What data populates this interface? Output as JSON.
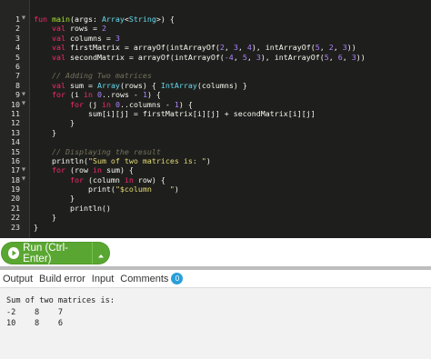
{
  "colors": {
    "keyword": "#f92672",
    "type": "#66d9ef",
    "func": "#a6e22e",
    "number": "#ae81ff",
    "string": "#e6db74",
    "comment": "#75715e",
    "plain": "#f8f8f2",
    "run_green": "#5aa632",
    "badge_blue": "#2a9fd8"
  },
  "editor": {
    "lines": [
      {
        "n": "1",
        "fold": true,
        "tokens": [
          [
            "k",
            "fun "
          ],
          [
            "f",
            "main"
          ],
          [
            "p",
            "(args: "
          ],
          [
            "t",
            "Array"
          ],
          [
            "p",
            "<"
          ],
          [
            "t",
            "String"
          ],
          [
            "p",
            ">) {"
          ]
        ]
      },
      {
        "n": "2",
        "fold": false,
        "tokens": [
          [
            "i",
            "    "
          ],
          [
            "k",
            "val "
          ],
          [
            "p",
            "rows = "
          ],
          [
            "m",
            "2"
          ]
        ]
      },
      {
        "n": "3",
        "fold": false,
        "tokens": [
          [
            "i",
            "    "
          ],
          [
            "k",
            "val "
          ],
          [
            "p",
            "columns = "
          ],
          [
            "m",
            "3"
          ]
        ]
      },
      {
        "n": "4",
        "fold": false,
        "tokens": [
          [
            "i",
            "    "
          ],
          [
            "k",
            "val "
          ],
          [
            "p",
            "firstMatrix = arrayOf(intArrayOf("
          ],
          [
            "m",
            "2"
          ],
          [
            "p",
            ", "
          ],
          [
            "m",
            "3"
          ],
          [
            "p",
            ", "
          ],
          [
            "m",
            "4"
          ],
          [
            "p",
            "), intArrayOf("
          ],
          [
            "m",
            "5"
          ],
          [
            "p",
            ", "
          ],
          [
            "m",
            "2"
          ],
          [
            "p",
            ", "
          ],
          [
            "m",
            "3"
          ],
          [
            "p",
            "))"
          ]
        ]
      },
      {
        "n": "5",
        "fold": false,
        "tokens": [
          [
            "i",
            "    "
          ],
          [
            "k",
            "val "
          ],
          [
            "p",
            "secondMatrix = arrayOf(intArrayOf("
          ],
          [
            "m",
            "-4"
          ],
          [
            "p",
            ", "
          ],
          [
            "m",
            "5"
          ],
          [
            "p",
            ", "
          ],
          [
            "m",
            "3"
          ],
          [
            "p",
            "), intArrayOf("
          ],
          [
            "m",
            "5"
          ],
          [
            "p",
            ", "
          ],
          [
            "m",
            "6"
          ],
          [
            "p",
            ", "
          ],
          [
            "m",
            "3"
          ],
          [
            "p",
            "))"
          ]
        ]
      },
      {
        "n": "6",
        "fold": false,
        "tokens": []
      },
      {
        "n": "7",
        "fold": false,
        "tokens": [
          [
            "i",
            "    "
          ],
          [
            "c",
            "// Adding Two matrices"
          ]
        ]
      },
      {
        "n": "8",
        "fold": false,
        "tokens": [
          [
            "i",
            "    "
          ],
          [
            "k",
            "val "
          ],
          [
            "p",
            "sum = "
          ],
          [
            "t",
            "Array"
          ],
          [
            "p",
            "(rows) { "
          ],
          [
            "t",
            "IntArray"
          ],
          [
            "p",
            "(columns) }"
          ]
        ]
      },
      {
        "n": "9",
        "fold": true,
        "tokens": [
          [
            "i",
            "    "
          ],
          [
            "k",
            "for "
          ],
          [
            "p",
            "(i "
          ],
          [
            "k",
            "in "
          ],
          [
            "m",
            "0"
          ],
          [
            "p",
            "..rows - "
          ],
          [
            "m",
            "1"
          ],
          [
            "p",
            ") {"
          ]
        ]
      },
      {
        "n": "10",
        "fold": true,
        "tokens": [
          [
            "i",
            "        "
          ],
          [
            "k",
            "for "
          ],
          [
            "p",
            "(j "
          ],
          [
            "k",
            "in "
          ],
          [
            "m",
            "0"
          ],
          [
            "p",
            "..columns - "
          ],
          [
            "m",
            "1"
          ],
          [
            "p",
            ") {"
          ]
        ]
      },
      {
        "n": "11",
        "fold": false,
        "tokens": [
          [
            "i",
            "            "
          ],
          [
            "p",
            "sum[i][j] = firstMatrix[i][j] + secondMatrix[i][j]"
          ]
        ]
      },
      {
        "n": "12",
        "fold": false,
        "tokens": [
          [
            "i",
            "        "
          ],
          [
            "p",
            "}"
          ]
        ]
      },
      {
        "n": "13",
        "fold": false,
        "tokens": [
          [
            "i",
            "    "
          ],
          [
            "p",
            "}"
          ]
        ]
      },
      {
        "n": "14",
        "fold": false,
        "tokens": []
      },
      {
        "n": "15",
        "fold": false,
        "tokens": [
          [
            "i",
            "    "
          ],
          [
            "c",
            "// Displaying the result"
          ]
        ]
      },
      {
        "n": "16",
        "fold": false,
        "tokens": [
          [
            "i",
            "    "
          ],
          [
            "p",
            "println("
          ],
          [
            "s",
            "\"Sum of two matrices is: \""
          ],
          [
            "p",
            ")"
          ]
        ]
      },
      {
        "n": "17",
        "fold": true,
        "tokens": [
          [
            "i",
            "    "
          ],
          [
            "k",
            "for "
          ],
          [
            "p",
            "(row "
          ],
          [
            "k",
            "in "
          ],
          [
            "p",
            "sum) {"
          ]
        ]
      },
      {
        "n": "18",
        "fold": true,
        "tokens": [
          [
            "i",
            "        "
          ],
          [
            "k",
            "for "
          ],
          [
            "p",
            "(column "
          ],
          [
            "k",
            "in "
          ],
          [
            "p",
            "row) {"
          ]
        ]
      },
      {
        "n": "19",
        "fold": false,
        "tokens": [
          [
            "i",
            "            "
          ],
          [
            "p",
            "print("
          ],
          [
            "s",
            "\"$column    \""
          ],
          [
            "p",
            ")"
          ]
        ]
      },
      {
        "n": "20",
        "fold": false,
        "tokens": [
          [
            "i",
            "        "
          ],
          [
            "p",
            "}"
          ]
        ]
      },
      {
        "n": "21",
        "fold": false,
        "tokens": [
          [
            "i",
            "        "
          ],
          [
            "p",
            "println()"
          ]
        ]
      },
      {
        "n": "22",
        "fold": false,
        "tokens": [
          [
            "i",
            "    "
          ],
          [
            "p",
            "}"
          ]
        ]
      },
      {
        "n": "23",
        "fold": false,
        "tokens": [
          [
            "p",
            "}"
          ]
        ]
      }
    ]
  },
  "run": {
    "label": "Run (Ctrl-Enter)",
    "icon": "play-circle-icon",
    "dropdown_icon": "chevron-up-icon"
  },
  "tabs": {
    "output": "Output",
    "build_error": "Build error",
    "input": "Input",
    "comments": "Comments",
    "comments_count": "0"
  },
  "output": {
    "lines": [
      "Sum of two matrices is:",
      "-2    8    7",
      "10    8    6"
    ]
  }
}
